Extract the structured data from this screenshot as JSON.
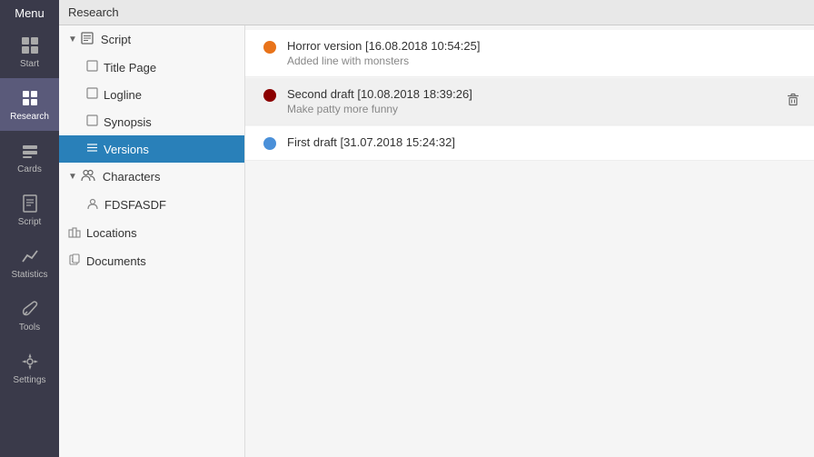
{
  "topbar": {
    "menu_label": "Menu",
    "section_label": "Research"
  },
  "sidebar": {
    "items": [
      {
        "id": "start",
        "label": "Start",
        "icon": "⊞"
      },
      {
        "id": "research",
        "label": "Research",
        "icon": "🏠",
        "active": true
      },
      {
        "id": "cards",
        "label": "Cards",
        "icon": "🃏"
      },
      {
        "id": "script",
        "label": "Script",
        "icon": "📄"
      },
      {
        "id": "statistics",
        "label": "Statistics",
        "icon": "📈"
      },
      {
        "id": "tools",
        "label": "Tools",
        "icon": "🔧"
      },
      {
        "id": "settings",
        "label": "Settings",
        "icon": "⚙"
      }
    ]
  },
  "tree": {
    "script_label": "Script",
    "title_page_label": "Title Page",
    "logline_label": "Logline",
    "synopsis_label": "Synopsis",
    "versions_label": "Versions",
    "characters_label": "Characters",
    "fdsfasdf_label": "FDSFASDF",
    "locations_label": "Locations",
    "documents_label": "Documents"
  },
  "versions": {
    "items": [
      {
        "title": "Horror version [16.08.2018 10:54:25]",
        "subtitle": "Added line with monsters",
        "dot_color": "#e8731a"
      },
      {
        "title": "Second draft [10.08.2018 18:39:26]",
        "subtitle": "Make patty more funny",
        "dot_color": "#8b0000",
        "show_delete": true
      },
      {
        "title": "First draft [31.07.2018 15:24:32]",
        "subtitle": "",
        "dot_color": "#4a90d9"
      }
    ],
    "delete_icon": "🗑"
  }
}
